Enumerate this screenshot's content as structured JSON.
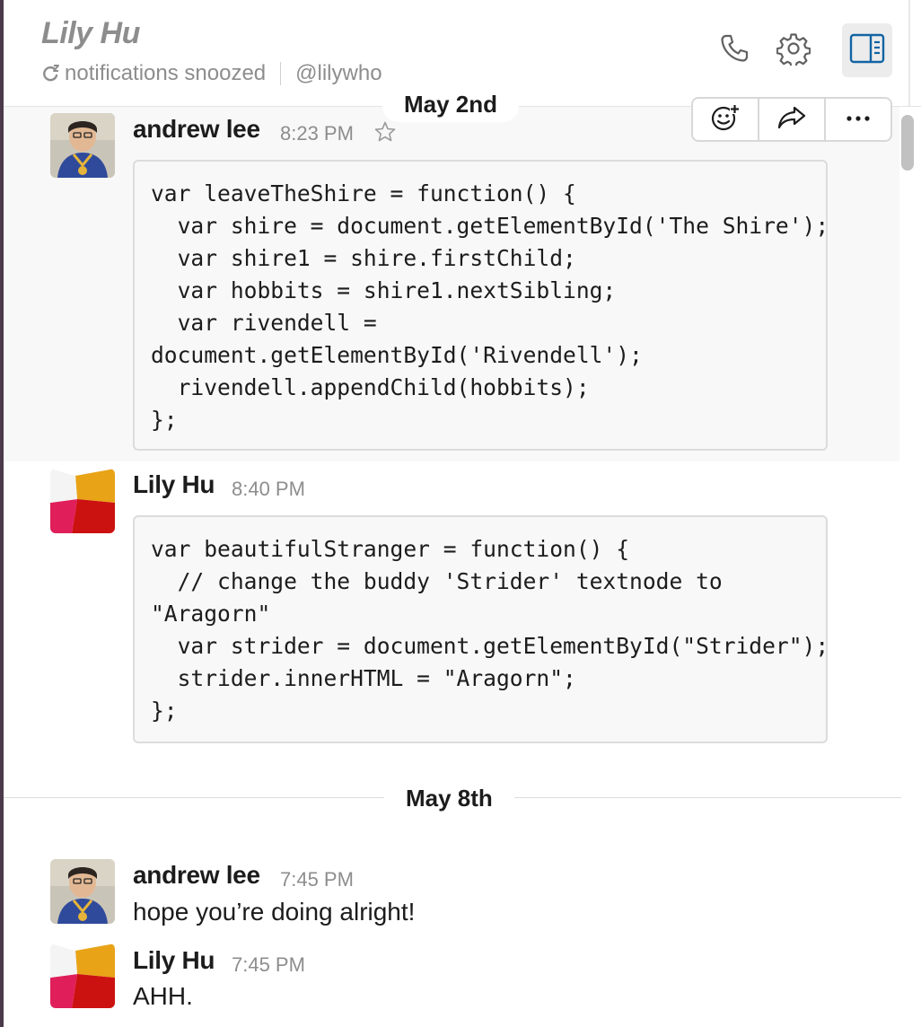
{
  "header": {
    "title": "Lily Hu",
    "status": "notifications snoozed",
    "handle": "@lilywho",
    "icons": [
      "phone-icon",
      "gear-icon",
      "sidebar-toggle-icon"
    ]
  },
  "dividers": {
    "first": "May 2nd",
    "second": "May 8th"
  },
  "message_actions": {
    "icons": [
      "add-reaction-icon",
      "share-icon",
      "more-icon"
    ]
  },
  "messages": [
    {
      "sender": "andrew lee",
      "time": "8:23 PM",
      "code": "var leaveTheShire = function() {\n  var shire = document.getElementById('The Shire');\n  var shire1 = shire.firstChild;\n  var hobbits = shire1.nextSibling;\n  var rivendell =\ndocument.getElementById('Rivendell');\n  rivendell.appendChild(hobbits);\n};"
    },
    {
      "sender": "Lily Hu",
      "time": "8:40 PM",
      "code": "var beautifulStranger = function() {\n  // change the buddy 'Strider' textnode to\n\"Aragorn\"\n  var strider = document.getElementById(\"Strider\");\n  strider.innerHTML = \"Aragorn\";\n};"
    },
    {
      "sender": "andrew lee",
      "time": "7:45 PM",
      "text": "hope you’re doing alright!"
    },
    {
      "sender": "Lily Hu",
      "time": "7:45 PM",
      "text": "AHH."
    }
  ],
  "colors": {
    "accent": "#1264a3",
    "muted": "#8d8d8d",
    "code_bg": "#f8f8f8",
    "border": "#dcdcdc"
  }
}
